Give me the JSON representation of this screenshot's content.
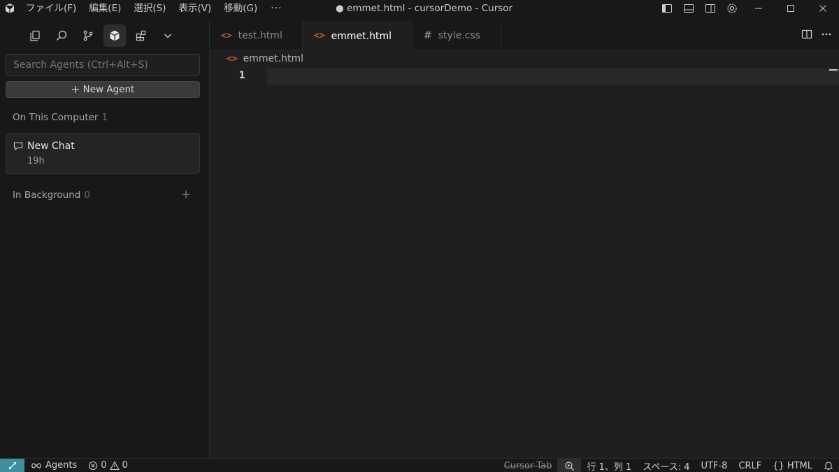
{
  "titlebar": {
    "menus": [
      "ファイル(F)",
      "編集(E)",
      "選択(S)",
      "表示(V)",
      "移動(G)"
    ],
    "more": "···",
    "window_title": "● emmet.html - cursorDemo - Cursor"
  },
  "sidebar": {
    "activity_icons": [
      "files-icon",
      "search-icon",
      "source-control-icon",
      "agents-cube-icon",
      "extensions-icon",
      "chevron-down-icon"
    ],
    "search_placeholder": "Search Agents (Ctrl+Alt+S)",
    "new_agent_label": "New Agent",
    "on_this_computer": {
      "label": "On This Computer",
      "count": "1"
    },
    "chats": [
      {
        "title": "New Chat",
        "time": "19h"
      }
    ],
    "in_background": {
      "label": "In Background",
      "count": "0"
    }
  },
  "editor": {
    "tabs": [
      {
        "label": "test.html",
        "icon": "<>",
        "active": false,
        "dirty": false
      },
      {
        "label": "emmet.html",
        "icon": "<>",
        "active": true,
        "dirty": true
      },
      {
        "label": "style.css",
        "icon": "#",
        "active": false,
        "dirty": false
      }
    ],
    "breadcrumb": "emmet.html",
    "line_number": "1"
  },
  "statusbar": {
    "agents": "Agents",
    "errors": "0",
    "warnings": "0",
    "cursor_tab": "Cursor Tab",
    "position": "行 1、列 1",
    "indent": "スペース: 4",
    "encoding": "UTF-8",
    "eol": "CRLF",
    "language": "HTML",
    "language_icon": "{}"
  },
  "colors": {
    "accent_remote": "#3e8e9e",
    "html_icon": "#e37933",
    "background": "#1f1f1f"
  }
}
